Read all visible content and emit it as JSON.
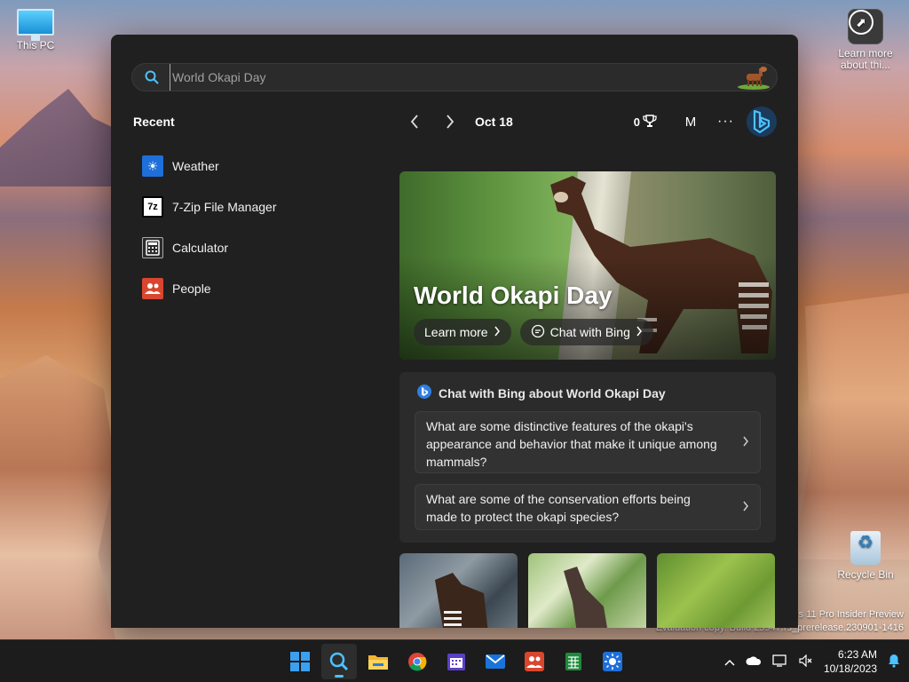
{
  "desktop": {
    "icons": {
      "this_pc": "This PC",
      "learn_more": "Learn more about thi...",
      "recycle_bin": "Recycle Bin"
    },
    "watermark": {
      "line1": "s 11 Pro Insider Preview",
      "line2": "Evaluation copy. Build 25947.rs_prerelease.230901-1416"
    }
  },
  "search": {
    "placeholder": "World Okapi Day"
  },
  "recent": {
    "heading": "Recent",
    "items": [
      {
        "label": "Weather",
        "icon": "weather-icon",
        "color": "#1e6fd9"
      },
      {
        "label": "7-Zip File Manager",
        "icon": "7zip-icon",
        "color": "#ffffff"
      },
      {
        "label": "Calculator",
        "icon": "calculator-icon",
        "color": "#3a3a3a"
      },
      {
        "label": "People",
        "icon": "people-icon",
        "color": "#d9462f"
      }
    ]
  },
  "nav": {
    "date": "Oct 18",
    "rewards": "0",
    "avatar": "M",
    "more": "···"
  },
  "hero": {
    "title": "World Okapi Day",
    "learn_more": "Learn more",
    "chat_with_bing": "Chat with Bing"
  },
  "chat": {
    "heading": "Chat with Bing about World Okapi Day",
    "questions": [
      "What are some distinctive features of the okapi's appearance and behavior that make it unique among mammals?",
      "What are some of the conservation efforts being made to protect the okapi species?"
    ]
  },
  "tray": {
    "time": "6:23 AM",
    "date": "10/18/2023"
  },
  "colors": {
    "accent": "#4cc2ff",
    "panel_bg": "#202020",
    "card_bg": "#2b2b2b"
  }
}
